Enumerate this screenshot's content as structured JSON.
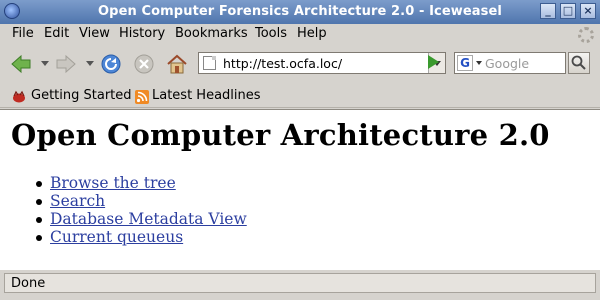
{
  "window": {
    "title": "Open Computer Forensics Architecture 2.0 - Iceweasel",
    "buttons": {
      "minimize": "_",
      "maximize": "□",
      "close": "×"
    }
  },
  "menu": {
    "items": [
      {
        "label": "File"
      },
      {
        "label": "Edit"
      },
      {
        "label": "View"
      },
      {
        "label": "History"
      },
      {
        "label": "Bookmarks"
      },
      {
        "label": "Tools"
      },
      {
        "label": "Help"
      }
    ]
  },
  "toolbar": {
    "url": "http://test.ocfa.loc/",
    "search_engine": "G",
    "search_placeholder": "Google",
    "icons": [
      "back-arrow-icon",
      "forward-arrow-icon",
      "reload-icon",
      "stop-icon",
      "home-icon",
      "go-icon",
      "magnifier-icon"
    ]
  },
  "bookmarks": {
    "items": [
      {
        "label": "Getting Started",
        "icon": "getting-started-icon"
      },
      {
        "label": "Latest Headlines",
        "icon": "rss-feed-icon"
      }
    ]
  },
  "page": {
    "heading": "Open Computer Architecture 2.0",
    "links": [
      {
        "label": "Browse the tree"
      },
      {
        "label": "Search"
      },
      {
        "label": "Database Metadata View"
      },
      {
        "label": "Current queueus"
      }
    ]
  },
  "status": {
    "text": "Done"
  },
  "colors": {
    "titlebar": "#5a7fb5",
    "link": "#2c3fa0",
    "chrome": "#d6d3ce"
  }
}
